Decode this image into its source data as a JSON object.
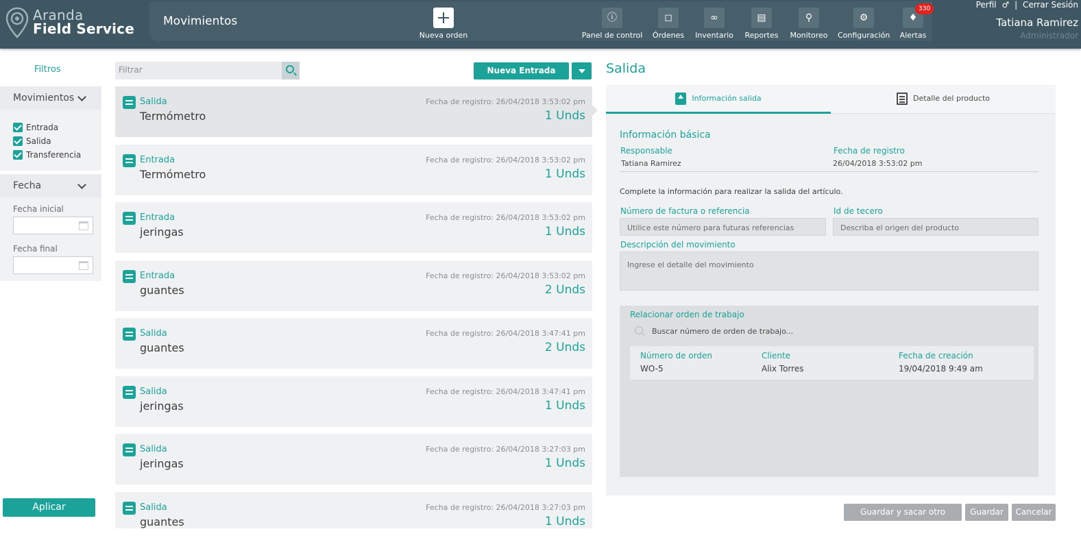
{
  "colors": {
    "accent": "#1ba39a",
    "header_bg": "#3e5762",
    "badge": "#e1231f"
  },
  "brand": {
    "line1": "Aranda",
    "line2": "Field Service"
  },
  "header": {
    "page_title": "Movimientos",
    "new_order_label": "Nueva orden",
    "nav": [
      {
        "label": "Panel de control",
        "icon": "gauge-icon"
      },
      {
        "label": "Órdenes",
        "icon": "window-icon"
      },
      {
        "label": "Inventario",
        "icon": "cart-icon"
      },
      {
        "label": "Reportes",
        "icon": "report-icon"
      },
      {
        "label": "Monitoreo",
        "icon": "map-pin-icon"
      },
      {
        "label": "Configuración",
        "icon": "gear-icon"
      },
      {
        "label": "Alertas",
        "icon": "bell-icon",
        "badge": "330"
      }
    ],
    "user": {
      "profile_link": "Perfil",
      "logout_link": "Cerrar Sesión",
      "name": "Tatiana Ramirez",
      "role": "Administrador"
    }
  },
  "sidebar": {
    "title": "Filtros",
    "movements_panel": {
      "title": "Movimientos",
      "options": [
        "Entrada",
        "Salida",
        "Transferencia"
      ]
    },
    "date_panel": {
      "title": "Fecha",
      "start_label": "Fecha inicial",
      "end_label": "Fecha final"
    },
    "apply_label": "Aplicar"
  },
  "list": {
    "filter_placeholder": "Filtrar",
    "new_entry_label": "Nueva Entrada",
    "items": [
      {
        "type": "Salida",
        "name": "Termómetro",
        "date": "Fecha de registro: 26/04/2018 3:53:02 pm",
        "qty": "1 Unds"
      },
      {
        "type": "Entrada",
        "name": "Termómetro",
        "date": "Fecha de registro: 26/04/2018 3:53:02 pm",
        "qty": "1 Unds"
      },
      {
        "type": "Entrada",
        "name": "jeringas",
        "date": "Fecha de registro: 26/04/2018 3:53:02 pm",
        "qty": "1 Unds"
      },
      {
        "type": "Entrada",
        "name": "guantes",
        "date": "Fecha de registro: 26/04/2018 3:53:02 pm",
        "qty": "2 Unds"
      },
      {
        "type": "Salida",
        "name": "guantes",
        "date": "Fecha de registro: 26/04/2018 3:47:41 pm",
        "qty": "2 Unds"
      },
      {
        "type": "Salida",
        "name": "jeringas",
        "date": "Fecha de registro: 26/04/2018 3:47:41 pm",
        "qty": "1 Unds"
      },
      {
        "type": "Salida",
        "name": "jeringas",
        "date": "Fecha de registro: 26/04/2018 3:27:03 pm",
        "qty": "1 Unds"
      },
      {
        "type": "Salida",
        "name": "guantes",
        "date": "Fecha de registro: 26/04/2018 3:27:03 pm",
        "qty": "1 Unds"
      }
    ]
  },
  "detail": {
    "title": "Salida",
    "tabs": [
      "Información salida",
      "Detalle del producto"
    ],
    "section_title": "Información básica",
    "responsible_label": "Responsable",
    "responsible_value": "Tatiana Ramirez",
    "reg_date_label": "Fecha de registro",
    "reg_date_value": "26/04/2018 3:53:02 pm",
    "hint": "Complete la información para realizar la salida del artículo.",
    "invoice_label": "Número de factura o referencia",
    "invoice_placeholder": "Utilice este número para futuras referencias",
    "third_label": "Id de tecero",
    "third_placeholder": "Describa el origen del producto",
    "desc_label": "Descripción del movimiento",
    "desc_placeholder": "Ingrese el detalle del movimiento",
    "work_order": {
      "title": "Relacionar orden de trabajo",
      "search_placeholder": "Buscar número de orden de trabajo...",
      "columns": [
        "Número de orden",
        "Cliente",
        "Fecha de creación"
      ],
      "row": [
        "WO-5",
        "Alix Torres",
        "19/04/2018 9:49 am"
      ]
    },
    "buttons": {
      "save_and_next": "Guardar y sacar otro producto",
      "save": "Guardar",
      "cancel": "Cancelar"
    }
  }
}
